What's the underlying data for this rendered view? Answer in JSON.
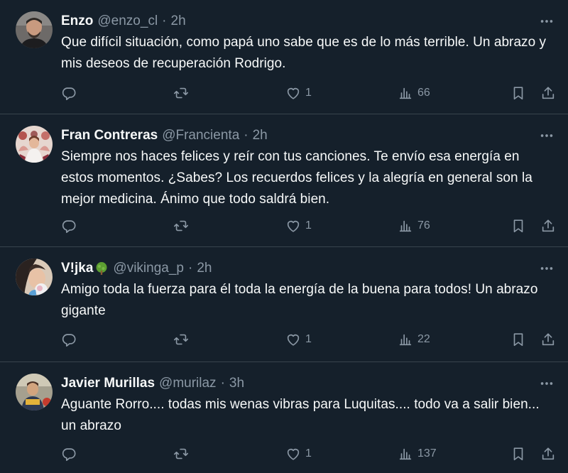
{
  "tweets": [
    {
      "name": "Enzo",
      "handle": "@enzo_cl",
      "separator": "·",
      "time": "2h",
      "text": "Que difícil situación, como papá uno sabe que es de lo más terrible. Un abrazo y mis deseos de recuperación Rodrigo.",
      "likes": "1",
      "views": "66"
    },
    {
      "name": "Fran Contreras",
      "handle": "@Francienta",
      "separator": "·",
      "time": "2h",
      "text": "Siempre nos haces felices y reír con tus canciones. Te envío esa energía en estos momentos. ¿Sabes? Los recuerdos felices y la alegría en general son la mejor medicina. Ánimo que todo saldrá bien.",
      "likes": "1",
      "views": "76"
    },
    {
      "name": "V!jka",
      "handle": "@vikinga_p",
      "separator": "·",
      "time": "2h",
      "text": "Amigo toda la fuerza para él toda la energía de la buena para todos! Un abrazo gigante",
      "likes": "1",
      "views": "22"
    },
    {
      "name": "Javier Murillas",
      "handle": "@murilaz",
      "separator": "·",
      "time": "3h",
      "text": "Aguante Rorro.... todas mis wenas vibras para Luquitas.... todo va a salir bien... un abrazo",
      "likes": "1",
      "views": "137"
    }
  ],
  "colors": {
    "background": "#15202b",
    "text": "#f7f9f9",
    "secondary": "#8b98a5",
    "divider": "#38444d"
  },
  "icons": [
    "more-icon",
    "reply-icon",
    "retweet-icon",
    "like-icon",
    "views-icon",
    "bookmark-icon",
    "share-icon",
    "tree-emoji-icon"
  ]
}
